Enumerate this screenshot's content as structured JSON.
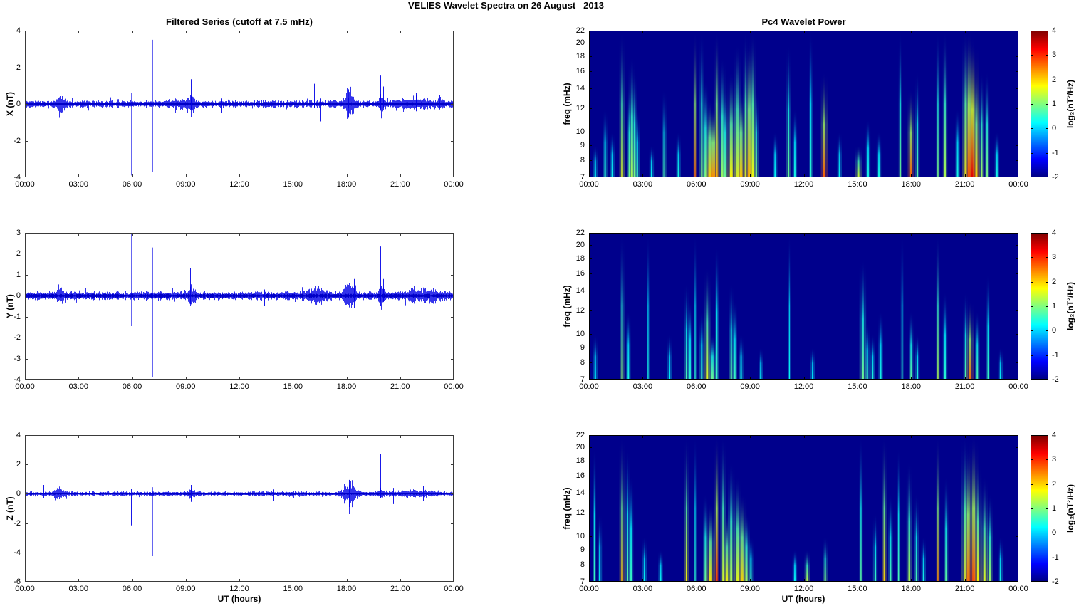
{
  "figure_title": "VELIES Wavelet Spectra on 26 August   2013",
  "left_column_title": "Filtered Series (cutoff at 7.5 mHz)",
  "right_column_title": "Pc4 Wavelet Power",
  "x_axis": {
    "label": "UT (hours)",
    "ticks": [
      "00:00",
      "03:00",
      "06:00",
      "09:00",
      "12:00",
      "15:00",
      "18:00",
      "21:00",
      "00:00"
    ],
    "hours": [
      0,
      3,
      6,
      9,
      12,
      15,
      18,
      21,
      24
    ]
  },
  "colorbar": {
    "label": "log₂(nT²/Hz)",
    "ticks": [
      4,
      3,
      2,
      1,
      0,
      -1,
      -2
    ],
    "min": -2,
    "max": 4
  },
  "colors": {
    "line": "#0000E6",
    "heat_background": "#00008C",
    "axis": "#3a3a3a"
  },
  "chart_data": [
    {
      "id": "ts-x",
      "type": "line",
      "panel": "timeseries",
      "ylabel": "X (nT)",
      "ylim": [
        -4,
        4
      ],
      "yticks": [
        4,
        2,
        0,
        -2,
        -4
      ],
      "xlim_hours": [
        0,
        24
      ],
      "noise_base": 0.13,
      "bursts": [
        [
          2.0,
          0.15,
          0.22
        ],
        [
          8.9,
          0.6,
          0.09
        ],
        [
          9.3,
          0.1,
          0.25
        ],
        [
          18.15,
          0.2,
          0.45
        ],
        [
          19.95,
          0.1,
          0.28
        ],
        [
          22.0,
          1.0,
          0.1
        ]
      ],
      "spikes": [
        [
          5.93,
          -3.9,
          0.6
        ],
        [
          7.15,
          -3.7,
          3.5
        ],
        [
          9.3,
          -0.3,
          1.35
        ],
        [
          13.75,
          -1.15,
          0.2
        ],
        [
          16.2,
          -0.2,
          1.1
        ],
        [
          16.55,
          -0.95,
          0.3
        ],
        [
          18.1,
          -0.75,
          0.8
        ],
        [
          19.9,
          -0.3,
          1.55
        ],
        [
          20.05,
          -0.2,
          0.95
        ],
        [
          2.0,
          -0.3,
          0.6
        ],
        [
          11.0,
          -0.5,
          0.3
        ],
        [
          21.9,
          -0.4,
          0.6
        ],
        [
          23.2,
          -0.3,
          0.5
        ]
      ]
    },
    {
      "id": "ts-y",
      "type": "line",
      "panel": "timeseries",
      "ylabel": "Y (nT)",
      "ylim": [
        -4,
        3
      ],
      "yticks": [
        3,
        2,
        1,
        0,
        -1,
        -2,
        -3,
        -4
      ],
      "xlim_hours": [
        0,
        24
      ],
      "noise_base": 0.13,
      "bursts": [
        [
          2.0,
          0.15,
          0.18
        ],
        [
          9.3,
          0.15,
          0.25
        ],
        [
          16.3,
          0.4,
          0.2
        ],
        [
          18.15,
          0.2,
          0.4
        ],
        [
          19.95,
          0.1,
          0.3
        ],
        [
          22.2,
          0.8,
          0.12
        ]
      ],
      "spikes": [
        [
          5.93,
          -1.45,
          3.0
        ],
        [
          7.15,
          -3.9,
          2.3
        ],
        [
          9.25,
          -0.4,
          1.3
        ],
        [
          9.45,
          -0.3,
          1.15
        ],
        [
          13.4,
          -0.5,
          0.3
        ],
        [
          16.1,
          -0.3,
          1.35
        ],
        [
          16.5,
          -0.3,
          1.2
        ],
        [
          17.5,
          -0.2,
          1.0
        ],
        [
          18.4,
          -0.6,
          0.8
        ],
        [
          19.9,
          -0.5,
          2.35
        ],
        [
          20.05,
          -0.3,
          0.8
        ],
        [
          21.8,
          -0.4,
          0.9
        ],
        [
          22.5,
          -0.35,
          0.85
        ],
        [
          2.0,
          -0.5,
          0.5
        ]
      ]
    },
    {
      "id": "ts-z",
      "type": "line",
      "panel": "timeseries",
      "ylabel": "Z (nT)",
      "ylim": [
        -6,
        4
      ],
      "yticks": [
        4,
        2,
        0,
        -2,
        -4,
        -6
      ],
      "xlim_hours": [
        0,
        24
      ],
      "noise_base": 0.1,
      "bursts": [
        [
          1.9,
          0.2,
          0.28
        ],
        [
          9.3,
          0.2,
          0.13
        ],
        [
          18.15,
          0.25,
          0.55
        ],
        [
          19.95,
          0.1,
          0.28
        ],
        [
          21.8,
          0.8,
          0.11
        ]
      ],
      "spikes": [
        [
          5.93,
          -2.15,
          0.35
        ],
        [
          7.15,
          -4.25,
          0.45
        ],
        [
          9.3,
          -0.55,
          0.6
        ],
        [
          13.9,
          -0.5,
          0.3
        ],
        [
          14.6,
          -0.9,
          0.3
        ],
        [
          16.5,
          -1.0,
          0.4
        ],
        [
          18.15,
          -0.9,
          0.95
        ],
        [
          19.9,
          -0.3,
          2.7
        ],
        [
          20.6,
          -0.7,
          0.4
        ],
        [
          2.0,
          -0.7,
          0.65
        ],
        [
          1.05,
          -0.3,
          0.6
        ],
        [
          22.3,
          -0.5,
          0.55
        ]
      ]
    },
    {
      "id": "sp-x",
      "type": "heatmap",
      "panel": "spectrogram",
      "ylabel": "freq (mHz)",
      "flim": [
        7,
        22
      ],
      "fticks": [
        22,
        20,
        18,
        16,
        14,
        12,
        10,
        9,
        8,
        7
      ],
      "clim": [
        -2,
        4
      ],
      "events": [
        [
          0.35,
          9,
          0.3,
          2
        ],
        [
          0.9,
          12,
          0.5,
          2
        ],
        [
          1.3,
          10,
          0.35,
          2
        ],
        [
          1.85,
          22,
          1.6,
          2.5
        ],
        [
          2.25,
          14,
          0.8,
          2
        ],
        [
          2.4,
          18,
          1.3,
          3
        ],
        [
          2.55,
          16,
          1.0,
          2.5
        ],
        [
          2.7,
          12,
          0.6,
          2
        ],
        [
          3.5,
          9,
          0.3,
          2
        ],
        [
          4.2,
          14,
          0.7,
          2
        ],
        [
          5.0,
          10,
          0.4,
          2
        ],
        [
          5.93,
          22,
          2.6,
          1.5
        ],
        [
          6.3,
          22,
          1.0,
          2
        ],
        [
          6.5,
          15,
          0.9,
          2.5
        ],
        [
          6.75,
          13,
          1.9,
          4
        ],
        [
          6.95,
          12,
          2.4,
          5
        ],
        [
          7.15,
          22,
          2.2,
          2
        ],
        [
          7.45,
          18,
          1.2,
          3
        ],
        [
          7.6,
          14,
          0.9,
          2
        ],
        [
          7.95,
          16,
          1.8,
          4
        ],
        [
          8.3,
          20,
          1.5,
          3
        ],
        [
          8.5,
          14,
          2.1,
          4
        ],
        [
          8.75,
          22,
          1.4,
          2
        ],
        [
          8.95,
          20,
          2.3,
          4
        ],
        [
          9.15,
          22,
          1.7,
          3
        ],
        [
          9.35,
          14,
          1.0,
          2
        ],
        [
          10.4,
          10,
          0.3,
          2
        ],
        [
          11.15,
          20,
          0.9,
          2
        ],
        [
          11.5,
          12,
          0.4,
          2
        ],
        [
          12.4,
          22,
          0.5,
          1.5
        ],
        [
          13.15,
          16,
          2.7,
          3
        ],
        [
          14.0,
          10,
          0.3,
          2
        ],
        [
          15.05,
          9,
          1.5,
          3
        ],
        [
          15.6,
          11,
          0.4,
          2
        ],
        [
          16.2,
          10,
          0.4,
          2
        ],
        [
          17.4,
          22,
          0.9,
          1.5
        ],
        [
          18.0,
          14,
          2.7,
          3
        ],
        [
          18.35,
          16,
          0.8,
          2
        ],
        [
          19.5,
          22,
          1.0,
          1.5
        ],
        [
          19.9,
          22,
          1.3,
          2
        ],
        [
          20.6,
          12,
          0.4,
          2
        ],
        [
          21.05,
          22,
          1.6,
          3
        ],
        [
          21.25,
          22,
          2.6,
          4
        ],
        [
          21.45,
          20,
          3.4,
          5
        ],
        [
          21.65,
          16,
          2.0,
          3
        ],
        [
          21.95,
          16,
          1.2,
          2
        ],
        [
          22.25,
          16,
          1.0,
          2
        ],
        [
          22.8,
          10,
          0.4,
          2
        ]
      ]
    },
    {
      "id": "sp-y",
      "type": "heatmap",
      "panel": "spectrogram",
      "ylabel": "freq (mHz)",
      "flim": [
        7,
        22
      ],
      "fticks": [
        22,
        20,
        18,
        16,
        14,
        12,
        10,
        9,
        8,
        7
      ],
      "clim": [
        -2,
        4
      ],
      "events": [
        [
          0.35,
          10,
          0.25,
          2
        ],
        [
          1.85,
          22,
          1.1,
          2
        ],
        [
          2.2,
          12,
          0.4,
          2
        ],
        [
          3.3,
          22,
          0.4,
          1.2
        ],
        [
          4.5,
          10,
          0.25,
          2
        ],
        [
          5.45,
          15,
          0.7,
          2
        ],
        [
          5.65,
          13,
          0.5,
          2
        ],
        [
          5.93,
          22,
          0.5,
          1.2
        ],
        [
          6.3,
          12,
          0.6,
          2
        ],
        [
          6.6,
          17,
          1.6,
          3
        ],
        [
          6.9,
          10,
          0.9,
          3
        ],
        [
          7.15,
          20,
          0.6,
          1.5
        ],
        [
          7.95,
          15,
          0.8,
          2
        ],
        [
          8.15,
          13,
          0.6,
          2
        ],
        [
          8.5,
          10,
          0.35,
          2
        ],
        [
          9.6,
          9,
          0.3,
          2
        ],
        [
          11.2,
          22,
          0.3,
          1.2
        ],
        [
          12.5,
          9,
          0.25,
          2
        ],
        [
          15.3,
          18,
          0.9,
          3
        ],
        [
          15.55,
          11,
          0.6,
          2
        ],
        [
          15.85,
          10,
          0.45,
          2
        ],
        [
          16.3,
          12,
          0.4,
          2
        ],
        [
          17.5,
          22,
          0.5,
          1.2
        ],
        [
          18.0,
          12,
          0.8,
          2
        ],
        [
          18.35,
          10,
          0.45,
          2
        ],
        [
          19.5,
          22,
          1.3,
          1.5
        ],
        [
          19.9,
          14,
          0.5,
          2
        ],
        [
          21.05,
          14,
          0.8,
          2
        ],
        [
          21.3,
          13,
          2.6,
          3
        ],
        [
          21.7,
          12,
          0.7,
          2
        ],
        [
          22.3,
          16,
          0.6,
          1.5
        ],
        [
          23.0,
          9,
          0.3,
          2
        ]
      ]
    },
    {
      "id": "sp-z",
      "type": "heatmap",
      "panel": "spectrogram",
      "ylabel": "freq (mHz)",
      "flim": [
        7,
        22
      ],
      "fticks": [
        22,
        20,
        18,
        16,
        14,
        12,
        10,
        9,
        8,
        7
      ],
      "clim": [
        -2,
        4
      ],
      "events": [
        [
          0.3,
          20,
          0.6,
          1.5
        ],
        [
          0.6,
          12,
          0.3,
          2
        ],
        [
          1.85,
          22,
          2.1,
          2.5
        ],
        [
          2.15,
          20,
          0.8,
          2
        ],
        [
          2.35,
          16,
          0.6,
          2
        ],
        [
          3.1,
          10,
          0.3,
          2
        ],
        [
          4.0,
          9,
          0.3,
          2
        ],
        [
          5.45,
          22,
          1.8,
          2
        ],
        [
          5.93,
          22,
          0.5,
          1.2
        ],
        [
          6.5,
          14,
          0.9,
          2
        ],
        [
          6.8,
          13,
          1.9,
          4
        ],
        [
          7.15,
          22,
          2.9,
          2
        ],
        [
          7.5,
          22,
          1.5,
          2.5
        ],
        [
          7.7,
          12,
          1.8,
          3
        ],
        [
          7.95,
          18,
          1.3,
          3
        ],
        [
          8.3,
          16,
          1.6,
          3
        ],
        [
          8.55,
          14,
          2.0,
          4
        ],
        [
          8.8,
          12,
          1.2,
          3
        ],
        [
          9.05,
          10,
          0.6,
          2
        ],
        [
          11.5,
          9,
          0.3,
          2
        ],
        [
          12.2,
          9,
          1.4,
          2.5
        ],
        [
          13.2,
          10,
          1.0,
          2
        ],
        [
          15.2,
          22,
          0.8,
          1.5
        ],
        [
          16.0,
          12,
          0.6,
          2
        ],
        [
          16.5,
          22,
          2.0,
          2
        ],
        [
          16.85,
          14,
          0.7,
          2
        ],
        [
          17.3,
          20,
          0.7,
          1.5
        ],
        [
          17.9,
          18,
          1.3,
          2.5
        ],
        [
          18.3,
          14,
          0.7,
          2
        ],
        [
          18.7,
          10,
          0.4,
          2
        ],
        [
          19.5,
          22,
          2.4,
          1.5
        ],
        [
          19.95,
          16,
          0.8,
          2
        ],
        [
          21.0,
          22,
          1.4,
          3
        ],
        [
          21.2,
          20,
          2.6,
          4
        ],
        [
          21.5,
          22,
          2.8,
          4
        ],
        [
          21.75,
          18,
          1.8,
          3
        ],
        [
          22.1,
          16,
          1.6,
          3
        ],
        [
          22.4,
          14,
          1.2,
          2.5
        ],
        [
          23.0,
          10,
          0.4,
          2
        ]
      ]
    }
  ]
}
